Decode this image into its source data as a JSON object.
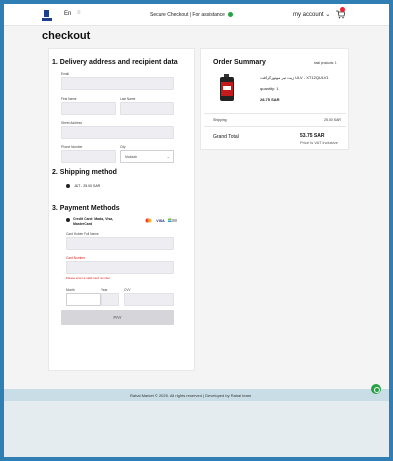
{
  "header": {
    "lang": "En",
    "secure_text": "Secure Checkout | For assistance",
    "account": "my account",
    "cart_count": ""
  },
  "page": {
    "title": "checkout"
  },
  "delivery": {
    "title": "1. Delivery address and recipient data",
    "email_label": "Email",
    "first_name_label": "First Name",
    "last_name_label": "Last Name",
    "street_label": "Street Address",
    "phone_label": "Phone Number",
    "city_label": "City",
    "city_value": "Makkah"
  },
  "shipping": {
    "title": "2. Shipping method",
    "option": "J&T - 25.00 SAR"
  },
  "payment": {
    "title": "3. Payment Methods",
    "option": "Credit Card: Mada, Visa, MasterCard",
    "holder_label": "Card Holder Full Name",
    "number_label": "Card Number",
    "number_error": "Please enter a valid card number",
    "month_label": "Month",
    "year_label": "Year",
    "cvv_label": "CVV",
    "pay_label": "PAY",
    "card_logos": [
      "mastercard",
      "visa",
      "mada"
    ]
  },
  "summary": {
    "title": "Order Summary",
    "total_products": "total products: 1",
    "product_name": "زيت تير موتوركرافت ULV - XT12QULV1",
    "quantity": "quantity: 1",
    "price": "28.75 SAR",
    "shipping_label": "Shipping",
    "shipping_value": "25.00 SAR",
    "grand_total_label": "Grand Total",
    "grand_total_value": "53.75 SAR",
    "vat_note": "Price is VAT inclusive"
  },
  "footer": {
    "text": "Rahal Market © 2025. All rights reserved | Developed by Rahal team"
  },
  "colors": {
    "accent": "#2f7fb5",
    "error": "#d22222",
    "whatsapp": "#25a244"
  }
}
